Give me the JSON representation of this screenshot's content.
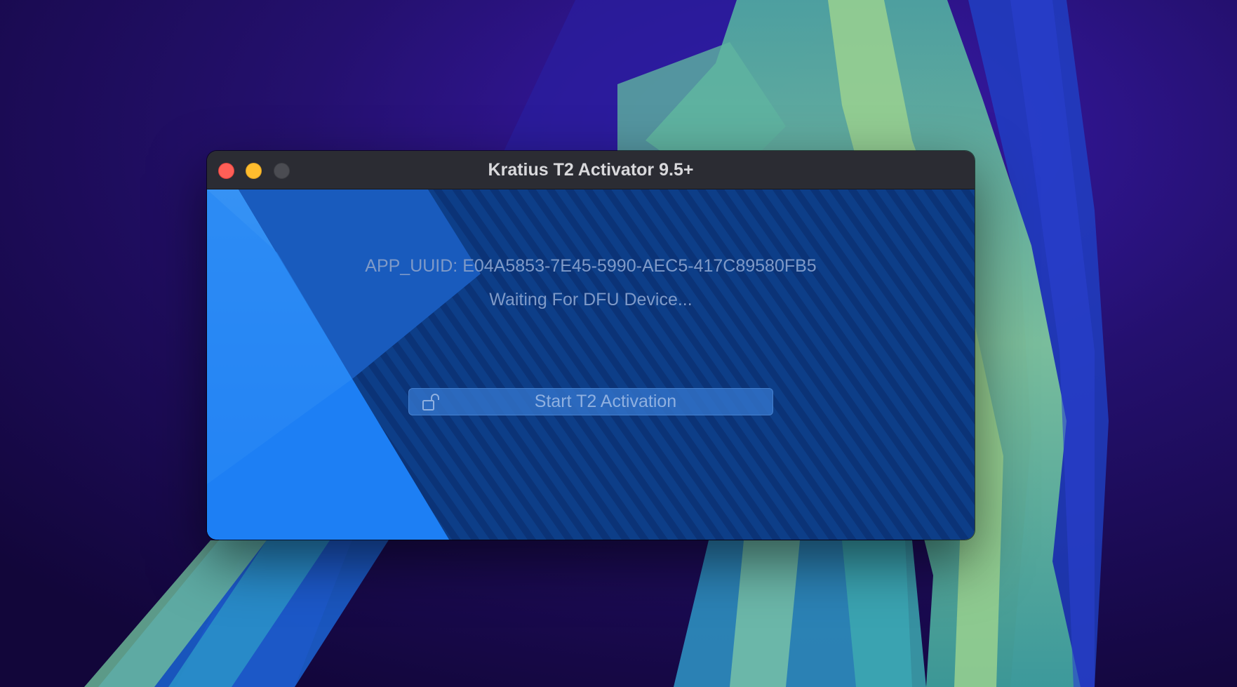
{
  "window": {
    "title": "Kratius T2 Activator 9.5+"
  },
  "controls": {
    "close_icon": "close-icon",
    "minimize_icon": "minimize-icon",
    "zoom_icon": "zoom-icon"
  },
  "main": {
    "uuid_line": "APP_UUID: E04A5853-7E45-5990-AEC5-417C89580FB5",
    "status": "Waiting For DFU Device...",
    "start_button": {
      "label": "Start T2 Activation",
      "icon": "unlock-icon"
    }
  },
  "colors": {
    "titlebar": "#2b2c33",
    "close": "#fe5f57",
    "minimize": "#febc2e",
    "zoom_inactive": "#4b4c52",
    "content_dark_blue": "#0d3e86",
    "content_light_blue": "#1f85ff",
    "text_muted": "#7f9ac8"
  }
}
